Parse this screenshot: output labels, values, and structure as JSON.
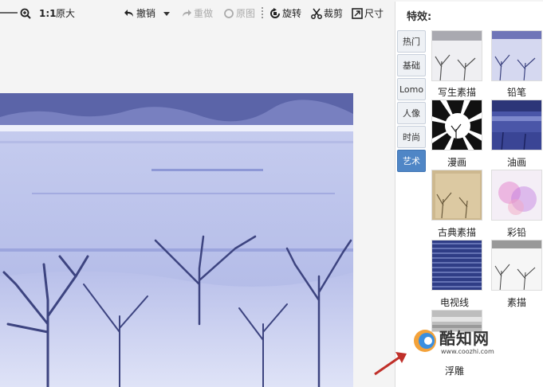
{
  "toolbar": {
    "ratio_label": "1:1",
    "actual_size": "原大",
    "undo": "撤销",
    "redo": "重做",
    "original": "原图",
    "rotate": "旋转",
    "crop": "裁剪",
    "size": "尺寸"
  },
  "panel": {
    "title": "特效:",
    "tabs": [
      "热门",
      "基础",
      "Lomo",
      "人像",
      "时尚",
      "艺术"
    ],
    "active_tab": "艺术",
    "effects": [
      "写生素描",
      "铅笔",
      "漫画",
      "油画",
      "古典素描",
      "彩铅",
      "电视线",
      "素描",
      "浮雕"
    ]
  },
  "watermark": {
    "name": "酷知网",
    "url": "www.coozhi.com"
  },
  "colors": {
    "accent": "#4f86c6",
    "photo_blue": "#9aa6dc"
  }
}
